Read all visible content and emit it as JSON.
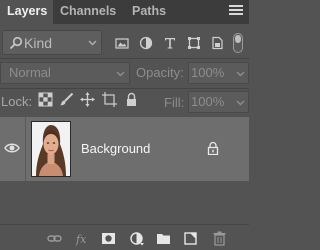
{
  "tabs": [
    {
      "label": "Layers",
      "active": true
    },
    {
      "label": "Channels",
      "active": false
    },
    {
      "label": "Paths",
      "active": false
    }
  ],
  "filter": {
    "kind_label": "Kind",
    "icons": [
      "pixel-layer-filter-icon",
      "adjustment-layer-filter-icon",
      "type-layer-filter-icon",
      "shape-layer-filter-icon",
      "smart-object-filter-icon"
    ]
  },
  "blend": {
    "mode": "Normal",
    "opacity_label": "Opacity:",
    "opacity_value": "100%"
  },
  "lock": {
    "label": "Lock:",
    "icons": [
      "lock-transparent-pixels-icon",
      "lock-image-pixels-icon",
      "lock-position-icon",
      "lock-artboard-icon",
      "lock-all-icon"
    ],
    "fill_label": "Fill:",
    "fill_value": "100%"
  },
  "layers": [
    {
      "name": "Background",
      "visible": true,
      "locked": true,
      "selected": true
    }
  ],
  "footer_icons": [
    "link-layers-icon",
    "fx-icon",
    "add-mask-icon",
    "new-fill-adjustment-icon",
    "new-group-icon",
    "new-layer-icon",
    "delete-layer-icon"
  ],
  "colors": {
    "panel_bg": "#535353",
    "tab_bar_bg": "#3c3c3c",
    "selected_row_bg": "#6e6e6e",
    "text_light": "#f5f5f5",
    "text_dim": "#8d8d8d"
  }
}
